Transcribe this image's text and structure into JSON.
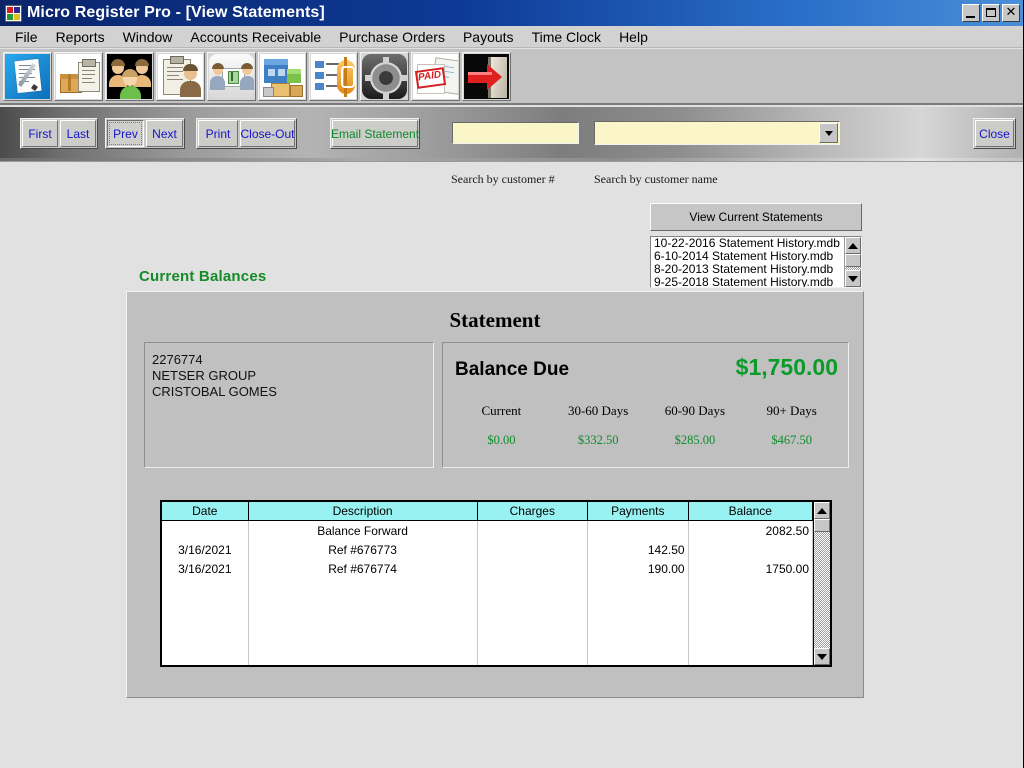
{
  "window": {
    "title": "Micro Register Pro - [View Statements]",
    "app_icon": "windows-logo-icon",
    "minimize_label": "Minimize",
    "restore_label": "Restore",
    "close_label": "✕"
  },
  "menubar": {
    "items": [
      {
        "label": "File"
      },
      {
        "label": "Reports"
      },
      {
        "label": "Window"
      },
      {
        "label": "Accounts Receivable"
      },
      {
        "label": "Purchase Orders"
      },
      {
        "label": "Payouts"
      },
      {
        "label": "Time Clock"
      },
      {
        "label": "Help"
      }
    ]
  },
  "toolbar": {
    "buttons": [
      {
        "icon": "invoice-pen-icon",
        "title": "New Invoice"
      },
      {
        "icon": "package-clipboard-icon",
        "title": "Inventory"
      },
      {
        "icon": "customers-people-icon",
        "title": "Customers"
      },
      {
        "icon": "employee-clipboard-icon",
        "title": "Employees"
      },
      {
        "icon": "meeting-money-icon",
        "title": "Accounts"
      },
      {
        "icon": "warehouse-icon",
        "title": "Warehouse"
      },
      {
        "icon": "list-dollar-icon",
        "title": "Pricing"
      },
      {
        "icon": "gears-settings-icon",
        "title": "Settings"
      },
      {
        "icon": "paid-invoice-icon",
        "title": "Paid Invoices"
      },
      {
        "icon": "exit-door-arrow-icon",
        "title": "Exit"
      }
    ]
  },
  "navbar": {
    "buttons": [
      {
        "label": "First",
        "accel": "i",
        "group": 0,
        "state": "normal",
        "color": "blue"
      },
      {
        "label": "Last",
        "accel": "t",
        "group": 0,
        "state": "normal",
        "color": "blue"
      },
      {
        "label": "Prev",
        "accel": "P",
        "group": 1,
        "state": "focused",
        "color": "blue"
      },
      {
        "label": "Next",
        "accel": "N",
        "group": 1,
        "state": "normal",
        "color": "blue"
      },
      {
        "label": "Print",
        "accel": "r",
        "group": 2,
        "state": "normal",
        "color": "blue"
      },
      {
        "label": "Close-Out",
        "accel": "C",
        "group": 2,
        "state": "normal",
        "color": "blue"
      },
      {
        "label": "Email Statement",
        "accel": "E",
        "group": 3,
        "state": "normal",
        "color": "green"
      },
      {
        "label": "Close",
        "accel": "l",
        "group": 4,
        "state": "normal",
        "color": "blue"
      }
    ],
    "search_customer_number": {
      "value": "",
      "placeholder": ""
    },
    "search_customer_name": {
      "value": "",
      "placeholder": ""
    },
    "dropdown_icon": "chevron-down-icon"
  },
  "labels": {
    "search_by_customer_number": "Search by customer #",
    "search_by_customer_name": "Search by customer name",
    "current_balances": "Current Balances"
  },
  "statements_panel": {
    "view_current_button": "View Current Statements",
    "history_files": [
      "10-22-2016 Statement History.mdb",
      "6-10-2014 Statement History.mdb",
      "8-20-2013 Statement History.mdb",
      "9-25-2018 Statement History.mdb"
    ],
    "scroll_up_icon": "triangle-up-icon",
    "scroll_down_icon": "triangle-down-icon"
  },
  "statement": {
    "title": "Statement",
    "customer": {
      "account_number": "2276774",
      "company": "NETSER GROUP",
      "contact": "CRISTOBAL GOMES"
    },
    "balance_due_label": "Balance Due",
    "balance_due_value": "$1,750.00",
    "aging": [
      {
        "label": "Current",
        "value": "$0.00"
      },
      {
        "label": "30-60 Days",
        "value": "$332.50"
      },
      {
        "label": "60-90 Days",
        "value": "$285.00"
      },
      {
        "label": "90+ Days",
        "value": "$467.50"
      }
    ],
    "grid": {
      "columns": [
        "Date",
        "Description",
        "Charges",
        "Payments",
        "Balance"
      ],
      "rows": [
        {
          "date": "",
          "description": "Balance Forward",
          "charges": "",
          "payments": "",
          "balance": "2082.50"
        },
        {
          "date": "3/16/2021",
          "description": "Ref #676773",
          "charges": "",
          "payments": "142.50",
          "balance": ""
        },
        {
          "date": "3/16/2021",
          "description": "Ref #676774",
          "charges": "",
          "payments": "190.00",
          "balance": "1750.00"
        }
      ],
      "scroll_up_icon": "triangle-up-icon",
      "scroll_down_icon": "triangle-down-icon"
    }
  },
  "colors": {
    "title_bar": "#0a246a",
    "accent_green": "#148c28",
    "money_green": "#0a9b2a",
    "grid_header": "#99f2f2",
    "button_text": "#1414cc",
    "field_yellow": "#fbf6c8",
    "window_face": "#c0c0c0",
    "desktop": "#e1e1e1"
  }
}
